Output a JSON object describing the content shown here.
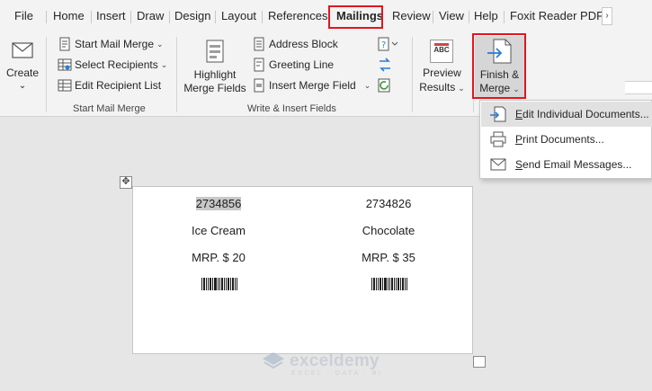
{
  "tabs": [
    "File",
    "Home",
    "Insert",
    "Draw",
    "Design",
    "Layout",
    "References",
    "Mailings",
    "Review",
    "View",
    "Help",
    "Foxit Reader PDF"
  ],
  "active_tab": "Mailings",
  "scroll_arrow": "›",
  "ribbon": {
    "create": {
      "label": "Create",
      "caret": "⌄"
    },
    "start_mail_merge": {
      "start_mail_merge": "Start Mail Merge",
      "select_recipients": "Select Recipients",
      "edit_recipient_list": "Edit Recipient List",
      "group_label": "Start Mail Merge"
    },
    "write_insert": {
      "highlight_line1": "Highlight",
      "highlight_line2": "Merge Fields",
      "address_block": "Address Block",
      "greeting_line": "Greeting Line",
      "insert_merge_field": "Insert Merge Field",
      "group_label": "Write & Insert Fields"
    },
    "preview": {
      "line1": "Preview",
      "line2": "Results",
      "icon_text": "ABC"
    },
    "finish": {
      "line1": "Finish &",
      "line2": "Merge"
    }
  },
  "dropdown": {
    "items": [
      {
        "label": "Edit Individual Documents...",
        "underline": "E",
        "rest": "dit Individual Documents..."
      },
      {
        "label": "Print Documents...",
        "underline": "P",
        "rest": "rint Documents..."
      },
      {
        "label": "Send Email Messages...",
        "underline": "S",
        "rest": "end Email Messages..."
      }
    ]
  },
  "labels": [
    {
      "code": "2734856",
      "product": "Ice Cream",
      "price": "MRP. $ 20"
    },
    {
      "code": "2734826",
      "product": "Chocolate",
      "price": "MRP. $ 35"
    }
  ],
  "watermark": {
    "name": "exceldemy",
    "sub": "EXCEL · DATA · BI"
  },
  "colors": {
    "highlight_box": "#e0161d",
    "ribbon_bg": "#f3f3f3",
    "doc_bg": "#e6e6e6",
    "accent_blue": "#2b7cd3"
  }
}
